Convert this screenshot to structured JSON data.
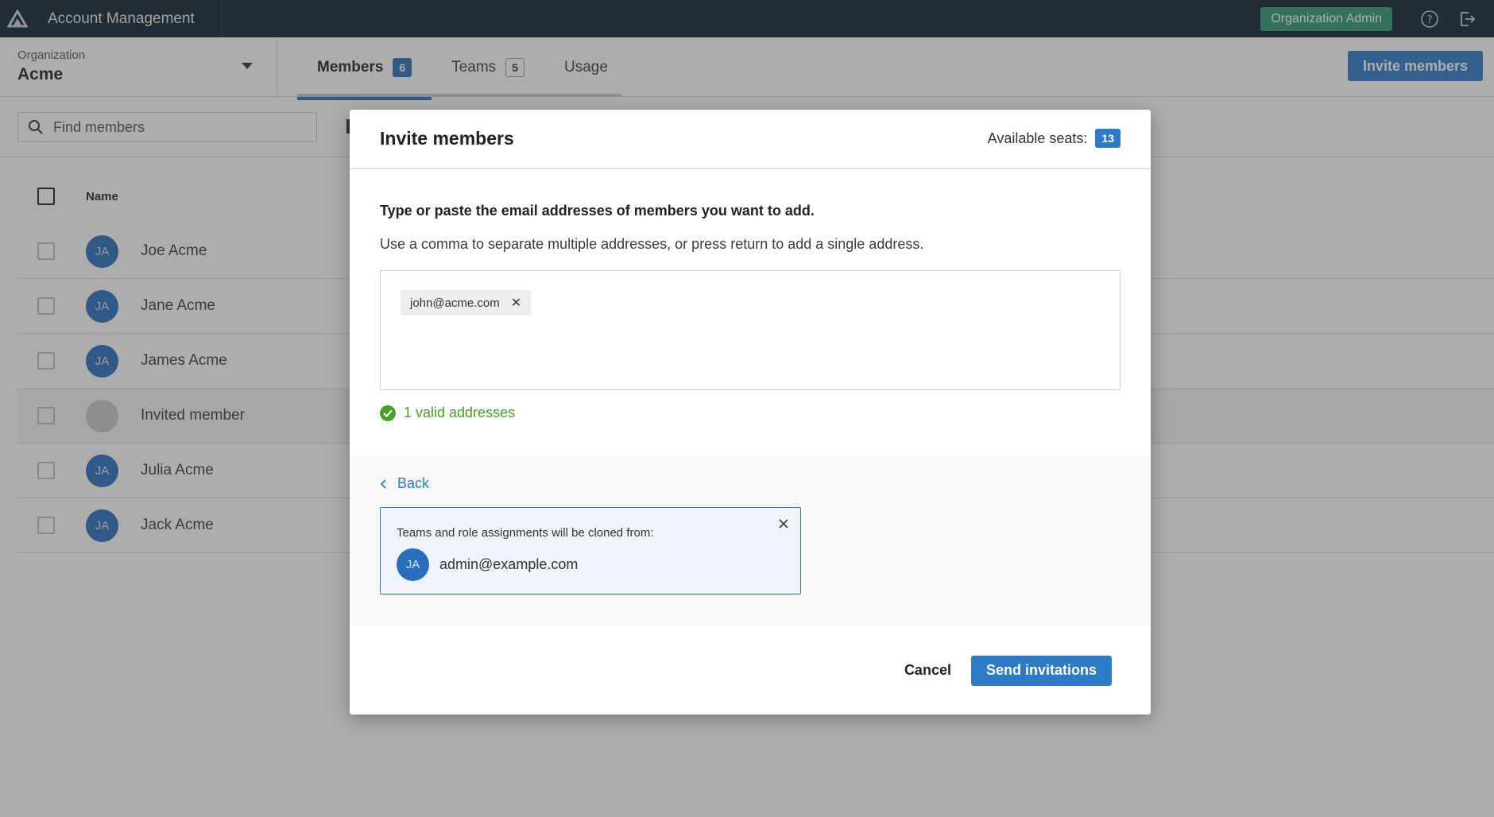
{
  "header": {
    "app_title": "Account Management",
    "role_badge": "Organization Admin",
    "icons": [
      "app-logo",
      "help-icon",
      "sign-out-icon"
    ]
  },
  "organization": {
    "label": "Organization",
    "name": "Acme"
  },
  "tabs": [
    {
      "label": "Members",
      "count": "6",
      "active": true
    },
    {
      "label": "Teams",
      "count": "5",
      "active": false
    },
    {
      "label": "Usage",
      "count": "",
      "active": false
    }
  ],
  "invite_button": "Invite members",
  "search": {
    "placeholder": "Find members"
  },
  "table": {
    "column_name": "Name",
    "rows": [
      {
        "initials": "JA",
        "name": "Joe Acme"
      },
      {
        "initials": "JA",
        "name": "Jane Acme"
      },
      {
        "initials": "JA",
        "name": "James Acme"
      },
      {
        "initials": "",
        "name": "Invited member"
      },
      {
        "initials": "JA",
        "name": "Julia Acme"
      },
      {
        "initials": "JA",
        "name": "Jack Acme"
      }
    ]
  },
  "modal": {
    "title": "Invite members",
    "seats_label": "Available seats:",
    "seats_count": "13",
    "instruction_bold": "Type or paste the email addresses of members you want to add.",
    "instruction": "Use a comma to separate multiple addresses, or press return to add a single address.",
    "chips": [
      "john@acme.com"
    ],
    "valid_text": "1 valid addresses",
    "back_label": "Back",
    "clone_label": "Teams and role assignments will be cloned from:",
    "clone_initials": "JA",
    "clone_email": "admin@example.com",
    "cancel_label": "Cancel",
    "send_label": "Send invitations"
  },
  "colors": {
    "topbar": "#0d2133",
    "accent": "#2d7ac6",
    "badge": "#2f9a78",
    "valid": "#46a02a"
  }
}
